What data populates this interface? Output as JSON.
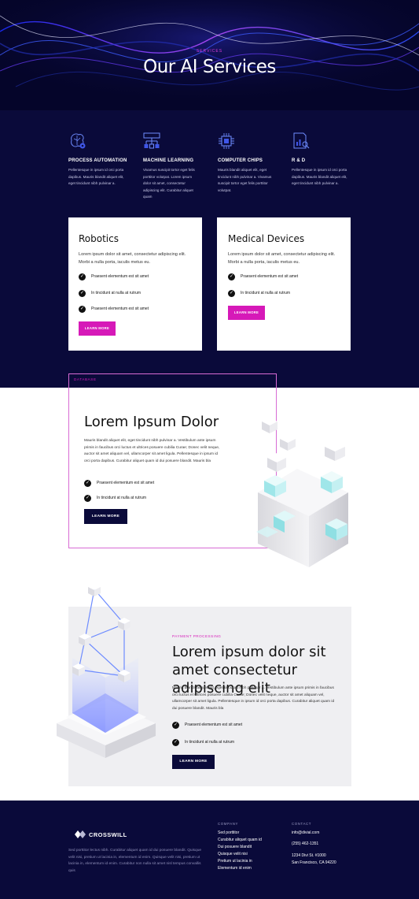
{
  "hero": {
    "eyebrow": "SERVICES",
    "title": "Our AI Services"
  },
  "services": [
    {
      "icon": "brain-gear-icon",
      "title": "PROCESS AUTOMATION",
      "desc": "Pellentesque in ipsum id orci porta dapibus. Mauris blandit aliquet elit, eget tincidunt nibh pulvinar a."
    },
    {
      "icon": "network-diagram-icon",
      "title": "MACHINE LEARNING",
      "desc": "Vivamus suscipit tortor eget felis porttitor volutpat. Lorem ipsum dolor sit amet, consectetur adipiscing elit. Curabitur aliquet quam"
    },
    {
      "icon": "chip-icon",
      "title": "COMPUTER CHIPS",
      "desc": "Mauris blandit aliquet elit, eget tincidunt nibh pulvinar a. Vivamus suscipit tortor eget felis porttitor volutpat."
    },
    {
      "icon": "report-magnifier-icon",
      "title": "R & D",
      "desc": "Pellentesque in ipsum id orci porta dapibus. Mauris blandit aliquet elit, eget tincidunt nibh pulvinar a."
    }
  ],
  "cards": [
    {
      "title": "Robotics",
      "desc": "Lorem ipsum dolor sit amet, consectetur adipiscing elit. Morbi a nulla porta, iaculis metus eu.",
      "items": [
        "Praesent elementum est sit amet",
        "In tincidunt at nulla at rutrum",
        "Praesent elementum est sit amet"
      ],
      "button": "LEARN MORE"
    },
    {
      "title": "Medical Devices",
      "desc": "Lorem ipsum dolor sit amet, consectetur adipiscing elit. Morbi a nulla porta, iaculis metus eu.",
      "items": [
        "Praesent elementum est sit amet",
        "In tincidunt at nulla at rutrum"
      ],
      "button": "LEARN MORE"
    }
  ],
  "database": {
    "eyebrow": "DATABASE",
    "title": "Lorem Ipsum Dolor",
    "desc": "Mauris blandit aliquet elit, eget tincidunt nibh pulvinar a. Vestibulum ante ipsum primis in faucibus orci luctus et ultrices posuere cubilia Curae; Donec velit neque, auctor sit amet aliquam vel, ullamcorper sit amet ligula. Pellentesque in ipsum id orci porta dapibus. Curabitur aliquet quam id dui posuere blandit. Mauris bla",
    "items": [
      "Praesent elementum est sit amet",
      "In tincidunt at nulla at rutrum"
    ],
    "button": "LEARN MORE"
  },
  "payment": {
    "eyebrow": "PAYMENT PROCESSING",
    "title": "Lorem ipsum dolor sit amet consectetur adipiscing elit",
    "desc": "Mauris blandit aliquet elit, eget tincidunt nibh pulvinar a. Vestibulum ante ipsum primis in faucibus orci luctus et ultrices posuere cubilia Curae; Donec velit neque, auctor sit amet aliquam vel, ullamcorper sit amet ligula. Pellentesque in ipsum id orci porta dapibus. Curabitur aliquet quam id dui posuere blandit. Mauris bla",
    "items": [
      "Praesent elementum est sit amet",
      "In tincidunt at nulla at rutrum"
    ],
    "button": "LEARN MORE"
  },
  "footer": {
    "logo": "CROSSWILL",
    "desc": "Sed porttitor lectus nibh. Curabitur aliquet quam id dui posuere blandit. Quisque velit nisi, pretium ut lacinia in, elementum id enim. Quisque velit nisi, pretium ut lacinia in, elementum id enim. Curabitur non nulla sit amet nisl tempus convallis quis",
    "company_heading": "COMPANY",
    "company_links": [
      "Sed porttitor",
      "Curabitur aliquet quam id",
      "Dui posuere blandit",
      "Quisque velit nisi",
      "Pretium ut lacinia in",
      "Elementum id enim"
    ],
    "contact_heading": "CONTACT",
    "email": "info@divial.com",
    "phone": "(255) 462-1351",
    "address1": "1234 Divi St. #1000",
    "address2": "San Francisco, CA 94220"
  },
  "colors": {
    "navy": "#0a0a3a",
    "accent_pink": "#d619b8",
    "light_gray": "#efeff2"
  }
}
